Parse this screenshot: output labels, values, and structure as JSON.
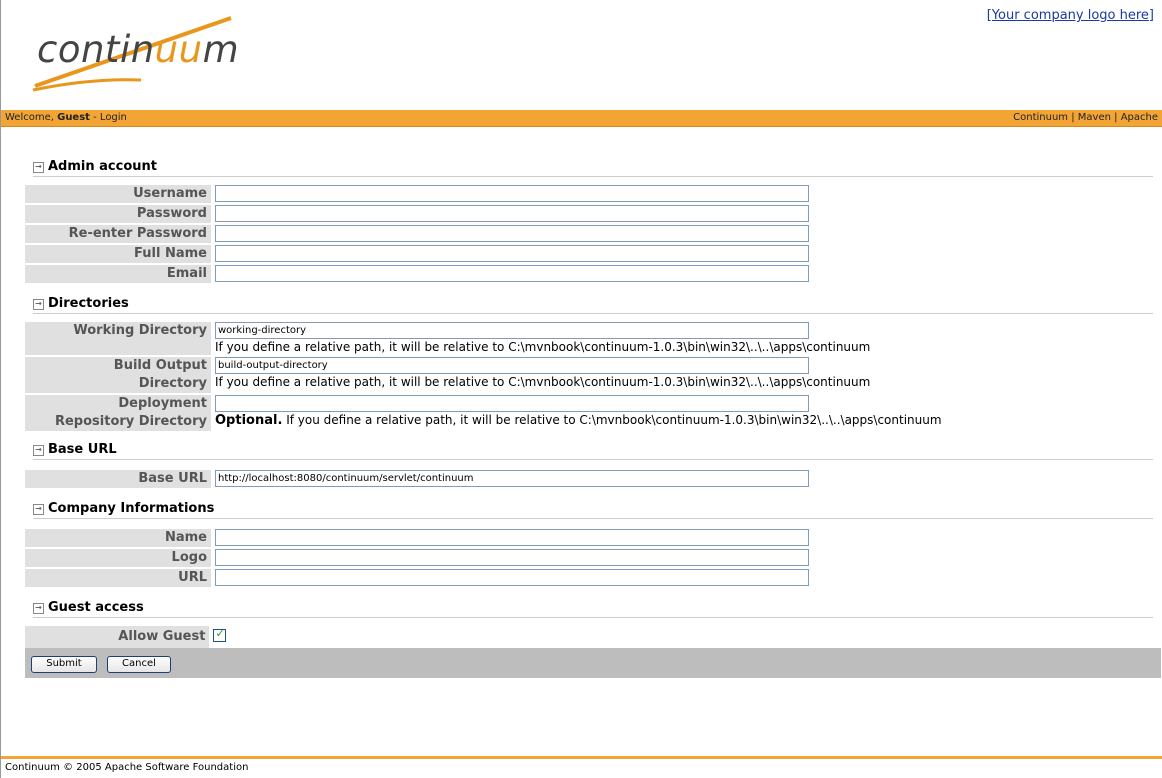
{
  "header": {
    "company_logo_link": "[Your company logo here]",
    "logo_text_a": "contin",
    "logo_text_b": "uu",
    "logo_text_c": "m"
  },
  "topbar": {
    "welcome": "Welcome, ",
    "user": "Guest",
    "separator": " - ",
    "login": "Login",
    "links": [
      "Continuum",
      "Maven",
      "Apache"
    ],
    "link_sep": " | "
  },
  "sections": {
    "admin": {
      "title": "Admin account",
      "username_label": "Username",
      "password_label": "Password",
      "reenter_label": "Re-enter Password",
      "fullname_label": "Full Name",
      "email_label": "Email"
    },
    "directories": {
      "title": "Directories",
      "working_label": "Working Directory",
      "working_value": "working-directory",
      "working_help": "If you define a relative path, it will be relative to C:\\mvnbook\\continuum-1.0.3\\bin\\win32\\..\\..\\apps\\continuum",
      "build_label_1": "Build Output",
      "build_label_2": "Directory",
      "build_value": "build-output-directory",
      "build_help": "If you define a relative path, it will be relative to C:\\mvnbook\\continuum-1.0.3\\bin\\win32\\..\\..\\apps\\continuum",
      "deploy_label_1": "Deployment",
      "deploy_label_2": "Repository Directory",
      "deploy_optional": "Optional.",
      "deploy_help": " If you define a relative path, it will be relative to C:\\mvnbook\\continuum-1.0.3\\bin\\win32\\..\\..\\apps\\continuum"
    },
    "baseurl": {
      "title": "Base URL",
      "label": "Base URL",
      "value": "http://localhost:8080/continuum/servlet/continuum"
    },
    "company": {
      "title": "Company Informations",
      "name_label": "Name",
      "logo_label": "Logo",
      "url_label": "URL"
    },
    "guest": {
      "title": "Guest access",
      "allow_label": "Allow Guest",
      "allow_checked": true
    }
  },
  "buttons": {
    "submit": "Submit",
    "cancel": "Cancel"
  },
  "footer": {
    "text": "Continuum © 2005 Apache Software Foundation"
  },
  "colors": {
    "accent": "#f2a534",
    "label_bg": "#e0e0e0",
    "button_bar": "#bdbdbd"
  }
}
